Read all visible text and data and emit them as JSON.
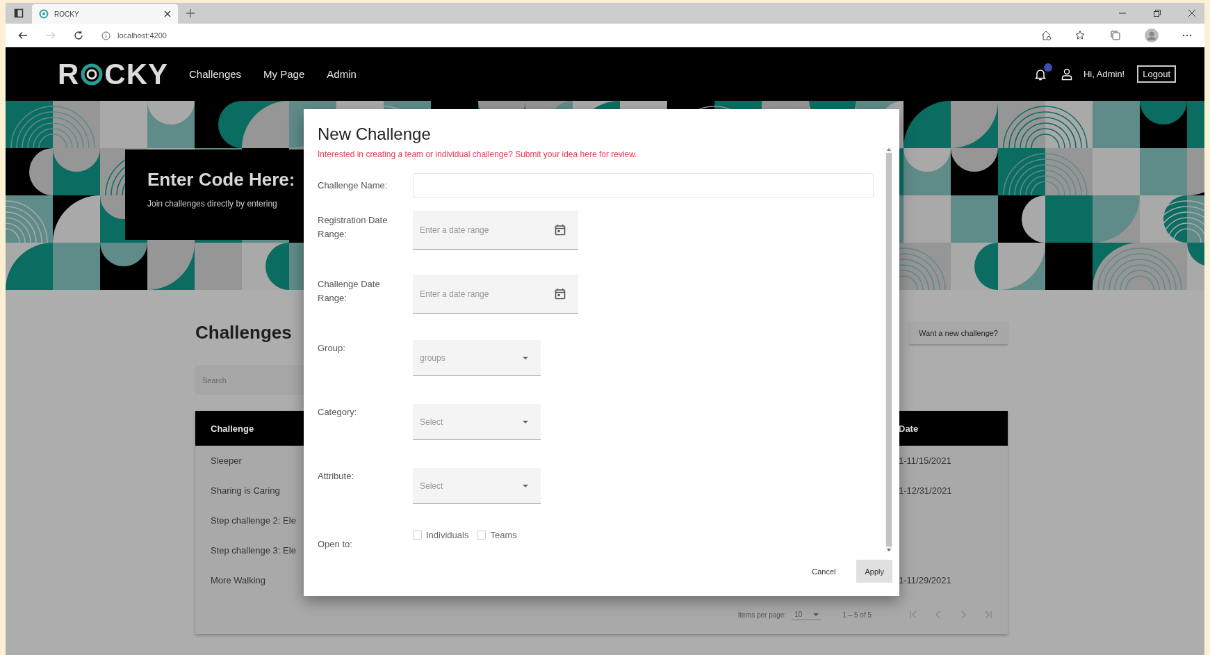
{
  "browser": {
    "tab_title": "ROCKY",
    "url": "localhost:4200"
  },
  "header": {
    "logo": [
      "R",
      "CKY"
    ],
    "nav": [
      {
        "label": "Challenges"
      },
      {
        "label": "My Page"
      },
      {
        "label": "Admin"
      }
    ],
    "greeting": "Hi, Admin!",
    "logout": "Logout"
  },
  "hero": {
    "title": "Enter Code Here:",
    "subtitle": "Join challenges directly by entering"
  },
  "challenges": {
    "title": "Challenges",
    "new_button": "Want a new challenge?",
    "search_placeholder": "Search",
    "columns": [
      {
        "label": "Challenge"
      },
      {
        "label": "Date"
      }
    ],
    "rows": [
      {
        "challenge": "Sleeper",
        "date": "1-11/15/2021"
      },
      {
        "challenge": "Sharing is Caring",
        "date": "1-12/31/2021"
      },
      {
        "challenge": "Step challenge 2: Ele"
      },
      {
        "challenge": "Step challenge 3: Ele"
      },
      {
        "challenge": "More Walking",
        "date": "1-11/29/2021"
      }
    ],
    "paginator": {
      "items_label": "Items per page:",
      "page_size": "10",
      "range": "1 – 5 of 5"
    }
  },
  "modal": {
    "title": "New Challenge",
    "note": "Interested in creating a team or individual challenge? Submit your idea here for review.",
    "fields": [
      {
        "kind": "text",
        "label": "Challenge Name:"
      },
      {
        "kind": "daterange",
        "label": "Registration Date Range:",
        "placeholder": "Enter a date range"
      },
      {
        "kind": "daterange",
        "label": "Challenge Date Range:",
        "placeholder": "Enter a date range"
      },
      {
        "kind": "select",
        "label": "Group:",
        "placeholder": "groups"
      },
      {
        "kind": "select",
        "label": "Category:",
        "placeholder": "Select"
      },
      {
        "kind": "select",
        "label": "Attribute:",
        "placeholder": "Select"
      },
      {
        "kind": "checkboxes",
        "label": "Open to:",
        "options": [
          {
            "label": "Individuals",
            "checked": false
          },
          {
            "label": "Teams",
            "checked": false
          }
        ]
      }
    ],
    "actions": [
      {
        "kind": "text",
        "label": "Cancel"
      },
      {
        "kind": "filled",
        "label": "Apply"
      }
    ]
  }
}
